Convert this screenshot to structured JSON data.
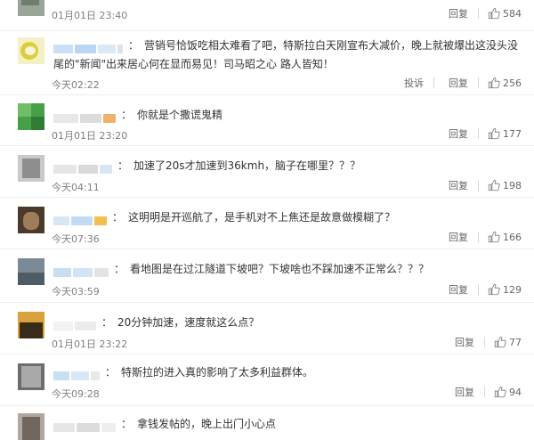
{
  "comments": [
    {
      "text": "",
      "time": "01月01日 23:40",
      "reply_label": "回复",
      "likes": "584",
      "report_label": ""
    },
    {
      "text": "营销号恰饭吃相太难看了吧，特斯拉白天刚宣布大减价，晚上就被爆出这没头没尾的\"新闻\"出来居心何在显而易见！司马昭之心 路人皆知！",
      "time": "今天02:22",
      "reply_label": "回复",
      "likes": "256",
      "report_label": "投诉"
    },
    {
      "text": "你就是个撒谎鬼精",
      "time": "01月01日 23:20",
      "reply_label": "回复",
      "likes": "177",
      "report_label": ""
    },
    {
      "text": "加速了20s才加速到36kmh，脑子在哪里？？？",
      "time": "今天04:11",
      "reply_label": "回复",
      "likes": "198",
      "report_label": ""
    },
    {
      "text": "这明明是开巡航了，是手机对不上焦还是故意做模糊了？",
      "time": "今天07:36",
      "reply_label": "回复",
      "likes": "166",
      "report_label": ""
    },
    {
      "text": "看地图是在过江隧道下坡吧？下坡啥也不踩加速不正常么？？？",
      "time": "今天03:59",
      "reply_label": "回复",
      "likes": "129",
      "report_label": ""
    },
    {
      "text": "20分钟加速，速度就这么点？",
      "time": "01月01日 23:22",
      "reply_label": "回复",
      "likes": "77",
      "report_label": ""
    },
    {
      "text": "特斯拉的进入真的影响了太多利益群体。",
      "time": "今天09:28",
      "reply_label": "回复",
      "likes": "94",
      "report_label": ""
    },
    {
      "text": "拿钱发帖的，晚上出门小心点",
      "time": "",
      "reply_label": "",
      "likes": "",
      "report_label": ""
    }
  ]
}
